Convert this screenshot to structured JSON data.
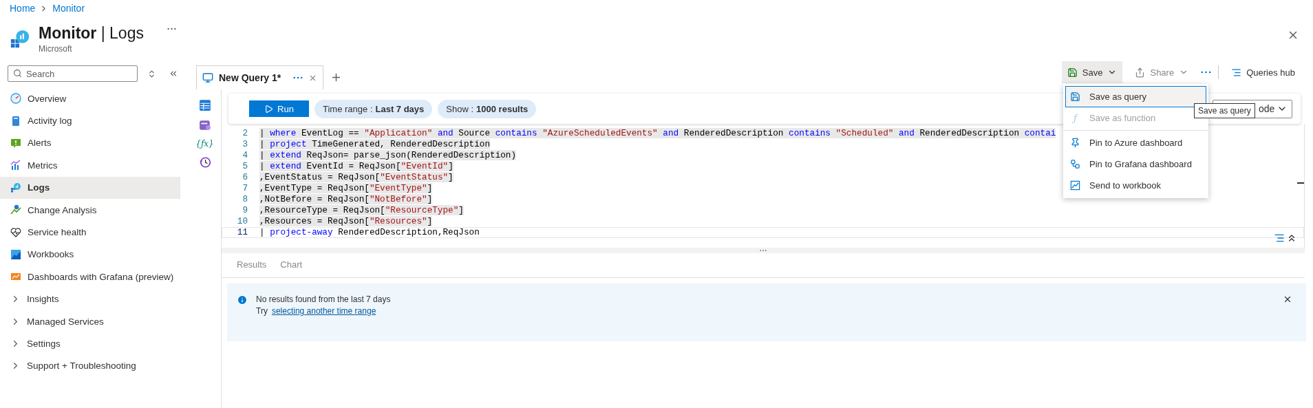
{
  "breadcrumb": [
    {
      "label": "Home"
    },
    {
      "label": "Monitor"
    }
  ],
  "header": {
    "title": "**Monitor** | Logs",
    "subtitle": "Microsoft"
  },
  "sidebar": {
    "search": {
      "placeholder": "Search"
    },
    "items": [
      {
        "label": "Overview",
        "kind": "link",
        "selected": false
      },
      {
        "label": "Activity log",
        "kind": "link",
        "selected": false
      },
      {
        "label": "Alerts",
        "kind": "link",
        "selected": false
      },
      {
        "label": "Metrics",
        "kind": "link",
        "selected": false
      },
      {
        "label": "Logs",
        "kind": "link",
        "selected": true
      },
      {
        "label": "Change Analysis",
        "kind": "link",
        "selected": false
      },
      {
        "label": "Service health",
        "kind": "link",
        "selected": false
      },
      {
        "label": "Workbooks",
        "kind": "link",
        "selected": false
      },
      {
        "label": "Dashboards with Grafana (preview)",
        "kind": "link",
        "selected": false
      },
      {
        "label": "Insights",
        "kind": "group",
        "expanded": false
      },
      {
        "label": "Managed Services",
        "kind": "group",
        "expanded": false
      },
      {
        "label": "Settings",
        "kind": "group",
        "expanded": false
      },
      {
        "label": "Support + Troubleshooting",
        "kind": "group",
        "expanded": false
      }
    ]
  },
  "query_tabs": [
    {
      "label": "New Query 1*",
      "selected": true
    }
  ],
  "actions": {
    "save": "Save",
    "share": "Share",
    "queries_hub": "Queries hub"
  },
  "rail": {
    "function_glyph": "{ƒx}"
  },
  "toolbar": {
    "run": "Run",
    "time_range": {
      "label": "Time range :",
      "value": "Last 7 days"
    },
    "show": {
      "label": "Show :",
      "value": "1000 results"
    },
    "mode": "ode"
  },
  "editor": {
    "lines": [
      {
        "number": "2",
        "highlighted": true,
        "current": false,
        "tokens": [
          {
            "kind": "plain",
            "text": "| "
          },
          {
            "kind": "keyword",
            "text": "where"
          },
          {
            "kind": "plain",
            "text": " EventLog == "
          },
          {
            "kind": "string",
            "text": "\"Application\""
          },
          {
            "kind": "keyword",
            "text": " and"
          },
          {
            "kind": "plain",
            "text": " Source "
          },
          {
            "kind": "keyword",
            "text": "contains"
          },
          {
            "kind": "string",
            "text": " \"AzureScheduledEvents\""
          },
          {
            "kind": "keyword",
            "text": " and"
          },
          {
            "kind": "plain",
            "text": " RenderedDescription "
          },
          {
            "kind": "keyword",
            "text": "contains"
          },
          {
            "kind": "string",
            "text": " \"Scheduled\""
          },
          {
            "kind": "keyword",
            "text": " and"
          },
          {
            "kind": "plain",
            "text": " RenderedDescription "
          },
          {
            "kind": "keyword",
            "text": "contai"
          }
        ]
      },
      {
        "number": "3",
        "highlighted": true,
        "current": false,
        "tokens": [
          {
            "kind": "plain",
            "text": "| "
          },
          {
            "kind": "keyword",
            "text": "project"
          },
          {
            "kind": "plain",
            "text": " TimeGenerated, RenderedDescription"
          }
        ]
      },
      {
        "number": "4",
        "highlighted": true,
        "current": false,
        "tokens": [
          {
            "kind": "plain",
            "text": "| "
          },
          {
            "kind": "keyword",
            "text": "extend"
          },
          {
            "kind": "plain",
            "text": " ReqJson= parse_json(RenderedDescription)"
          }
        ]
      },
      {
        "number": "5",
        "highlighted": true,
        "current": false,
        "tokens": [
          {
            "kind": "plain",
            "text": "| "
          },
          {
            "kind": "keyword",
            "text": "extend"
          },
          {
            "kind": "plain",
            "text": " EventId = ReqJson["
          },
          {
            "kind": "string",
            "text": "\"EventId\""
          },
          {
            "kind": "plain",
            "text": "]"
          }
        ]
      },
      {
        "number": "6",
        "highlighted": true,
        "current": false,
        "tokens": [
          {
            "kind": "plain",
            "text": ",EventStatus = ReqJson["
          },
          {
            "kind": "string",
            "text": "\"EventStatus\""
          },
          {
            "kind": "plain",
            "text": "]"
          }
        ]
      },
      {
        "number": "7",
        "highlighted": true,
        "current": false,
        "tokens": [
          {
            "kind": "plain",
            "text": ",EventType = ReqJson["
          },
          {
            "kind": "string",
            "text": "\"EventType\""
          },
          {
            "kind": "plain",
            "text": "]"
          }
        ]
      },
      {
        "number": "8",
        "highlighted": true,
        "current": false,
        "tokens": [
          {
            "kind": "plain",
            "text": ",NotBefore = ReqJson["
          },
          {
            "kind": "string",
            "text": "\"NotBefore\""
          },
          {
            "kind": "plain",
            "text": "]"
          }
        ]
      },
      {
        "number": "9",
        "highlighted": true,
        "current": false,
        "tokens": [
          {
            "kind": "plain",
            "text": ",ResourceType = ReqJson["
          },
          {
            "kind": "string",
            "text": "\"ResourceType\""
          },
          {
            "kind": "plain",
            "text": "]"
          }
        ]
      },
      {
        "number": "10",
        "highlighted": true,
        "current": false,
        "tokens": [
          {
            "kind": "plain",
            "text": ",Resources = ReqJson["
          },
          {
            "kind": "string",
            "text": "\"Resources\""
          },
          {
            "kind": "plain",
            "text": "]"
          }
        ]
      },
      {
        "number": "11",
        "highlighted": false,
        "current": true,
        "tokens": [
          {
            "kind": "plain",
            "text": "| "
          },
          {
            "kind": "keyword",
            "text": "project-away"
          },
          {
            "kind": "plain",
            "text": " RenderedDescription,ReqJson"
          }
        ]
      }
    ]
  },
  "results": {
    "tabs": [
      {
        "label": "Results",
        "selected": false
      },
      {
        "label": "Chart",
        "selected": false
      }
    ],
    "banner": {
      "message": "No results found from the last 7 days",
      "prefix": "Try",
      "link": "selecting another time range"
    }
  },
  "save_menu": {
    "items": [
      {
        "label": "Save as query",
        "selected": true,
        "disabled": false
      },
      {
        "label": "Save as function",
        "selected": false,
        "disabled": true,
        "glyph": "ƒ"
      },
      {
        "label": "Pin to Azure dashboard",
        "selected": false,
        "disabled": false,
        "divider": true
      },
      {
        "label": "Pin to Grafana dashboard",
        "selected": false,
        "disabled": false
      },
      {
        "label": "Send to workbook",
        "selected": false,
        "disabled": false
      }
    ]
  },
  "tooltip": "Save as query"
}
